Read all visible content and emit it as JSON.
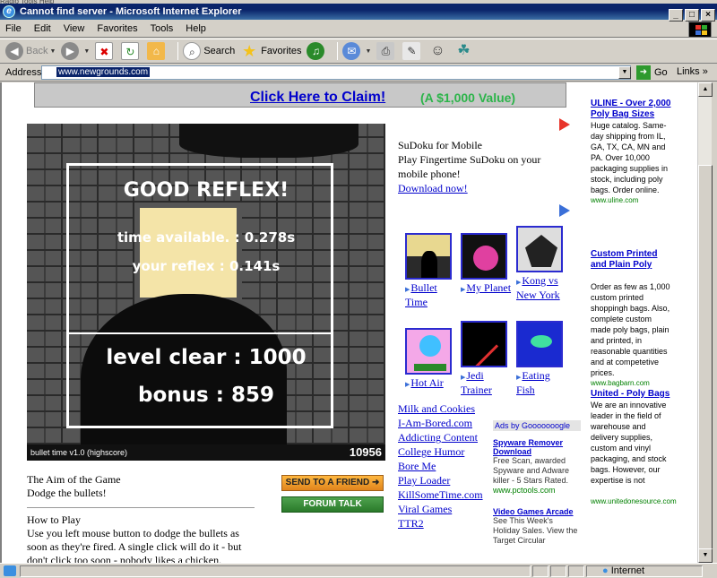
{
  "window": {
    "title": "Cannot find server - Microsoft Internet Explorer",
    "top_cut": "Radio Tools Help"
  },
  "menu": [
    "File",
    "Edit",
    "View",
    "Favorites",
    "Tools",
    "Help"
  ],
  "toolbar": {
    "back": "Back",
    "search": "Search",
    "favorites": "Favorites"
  },
  "address": {
    "label": "Address",
    "url": "www.newgrounds.com",
    "go": "Go",
    "links": "Links"
  },
  "banner": {
    "claim": "Click Here to Claim!",
    "value": "(A $1,000 Value)"
  },
  "game": {
    "title": "GOOD REFLEX!",
    "time_available": "time available. : 0.278s",
    "your_reflex": "your reflex : 0.141s",
    "level_clear": "level clear : 1000",
    "bonus": "bonus : 859",
    "footer": "bullet time v1.0 (highscore)",
    "score": "10956"
  },
  "sudoku": {
    "title": "SuDoku for Mobile",
    "body": "Play Fingertime SuDoku on your mobile phone!",
    "link": "Download now!"
  },
  "thumbs": [
    {
      "label": "Bullet Time"
    },
    {
      "label": "My Planet"
    },
    {
      "label": "Kong vs New York"
    },
    {
      "label": "Hot Air"
    },
    {
      "label": "Jedi Trainer"
    },
    {
      "label": "Eating Fish"
    }
  ],
  "games_list": [
    "Milk and Cookies",
    "I-Am-Bored.com",
    "Addicting Content",
    "College Humor",
    "Bore Me",
    "Play Loader",
    "KillSomeTime.com",
    "Viral Games",
    "TTR2"
  ],
  "google_ads": {
    "header": "Ads by Gooooooogle",
    "ads": [
      {
        "title": "Spyware Remover Download",
        "desc": "Free Scan, awarded Spyware and Adware killer - 5 Stars Rated.",
        "url": "www.pctools.com"
      },
      {
        "title": "Video Games Arcade",
        "desc": "See This Week's Holiday Sales. View the Target Circular",
        "url": ""
      }
    ]
  },
  "aim": {
    "heading": "The Aim of the Game",
    "text": "Dodge the bullets!",
    "howto_heading": "How to Play",
    "howto_text": "Use you left mouse button to dodge the bullets as soon as they're fired. A single click will do it - but don't click too soon - nobody likes a chicken."
  },
  "buttons": {
    "send": "SEND TO A FRIEND ➜",
    "forum": "FORUM TALK"
  },
  "side_ads": [
    {
      "title": "ULINE - Over 2,000 Poly Bag Sizes",
      "desc": "Huge catalog. Same-day shipping from IL, GA, TX, CA, MN and PA. Over 10,000 packaging supplies in stock, including poly bags. Order online.",
      "url": "www.uline.com"
    },
    {
      "title": "Custom Printed and Plain Poly",
      "desc": "Order as few as 1,000 custom printed shoppingh bags. Also, complete custom made poly bags, plain and printed, in reasonable quantities and at competetive prices.",
      "url": "www.bagbarn.com"
    },
    {
      "title": "United - Poly Bags",
      "desc": "We are an innovative leader in the field of warehouse and delivery supplies, custom and vinyl packaging, and stock bags. However, our expertise is not",
      "url": "www.unitedonesource.com"
    }
  ],
  "status": {
    "zone": "Internet"
  }
}
